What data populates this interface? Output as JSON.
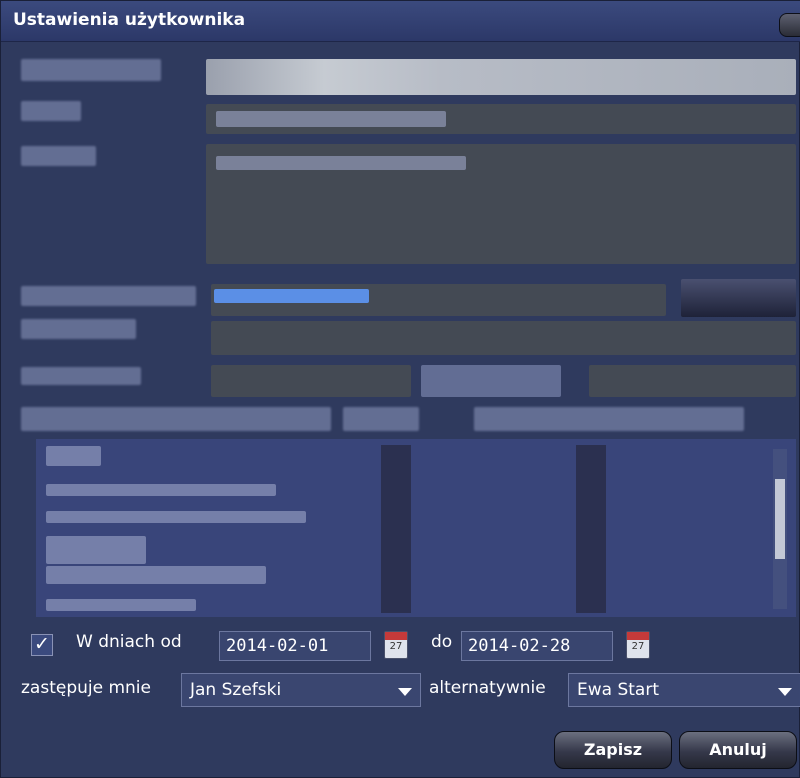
{
  "dialog": {
    "title": "Ustawienia użytkownika"
  },
  "absence": {
    "checked": true,
    "check_mark": "✓",
    "label_from": "W dniach od",
    "date_from": "2014-02-01",
    "label_to": "do",
    "date_to": "2014-02-28",
    "calendar_day": "27",
    "calendar_icon": "calendar-icon"
  },
  "substitute": {
    "label": "zastępuje mnie",
    "value": "Jan Szefski",
    "alt_label": "alternatywnie",
    "alt_value": "Ewa Start"
  },
  "buttons": {
    "save": "Zapisz",
    "cancel": "Anuluj"
  },
  "colors": {
    "background": "#2f3a5e",
    "titlebar": "#34427a",
    "text": "#ffffff"
  }
}
